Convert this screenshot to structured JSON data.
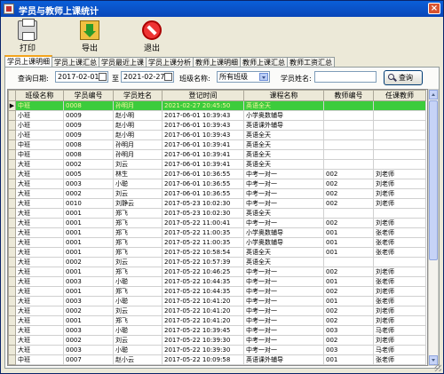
{
  "window": {
    "title": "学员与教师上课统计",
    "close_symbol": "×"
  },
  "toolbar": {
    "print": "打印",
    "export": "导出",
    "exit": "退出"
  },
  "tabs": [
    "学员上课明细",
    "学员上课汇总",
    "学员最近上课",
    "学员上课分析",
    "教师上课明细",
    "教师上课汇总",
    "教师工资汇总"
  ],
  "query": {
    "date_label": "查询日期:",
    "date_from": "2017-02-01",
    "to_label": "至",
    "date_to": "2021-02-27",
    "class_label": "班级名称:",
    "class_value": "所有班级",
    "student_label": "学员姓名:",
    "student_value": "",
    "search_button": "查询"
  },
  "table": {
    "columns": [
      "班级名称",
      "学员编号",
      "学员姓名",
      "登记时间",
      "课程名称",
      "教师编号",
      "任课教师"
    ],
    "selected_marker": "▶",
    "rows": [
      [
        "中班",
        "0008",
        "孙明月",
        "2021-02-27 20:45:50",
        "英语全天",
        "",
        ""
      ],
      [
        "小班",
        "0009",
        "赵小明",
        "2017-06-01 10:39:43",
        "小学奥数辅导",
        "",
        ""
      ],
      [
        "小班",
        "0009",
        "赵小明",
        "2017-06-01 10:39:43",
        "英语课外辅导",
        "",
        ""
      ],
      [
        "小班",
        "0009",
        "赵小明",
        "2017-06-01 10:39:43",
        "英语全天",
        "",
        ""
      ],
      [
        "中班",
        "0008",
        "孙明月",
        "2017-06-01 10:39:41",
        "英语全天",
        "",
        ""
      ],
      [
        "中班",
        "0008",
        "孙明月",
        "2017-06-01 10:39:41",
        "英语全天",
        "",
        ""
      ],
      [
        "大班",
        "0002",
        "刘云",
        "2017-06-01 10:39:41",
        "英语全天",
        "",
        ""
      ],
      [
        "大班",
        "0005",
        "林生",
        "2017-06-01 10:36:55",
        "中考一对一",
        "002",
        "刘老师"
      ],
      [
        "大班",
        "0003",
        "小聪",
        "2017-06-01 10:36:55",
        "中考一对一",
        "002",
        "刘老师"
      ],
      [
        "大班",
        "0002",
        "刘云",
        "2017-06-01 10:36:55",
        "中考一对一",
        "002",
        "刘老师"
      ],
      [
        "大班",
        "0010",
        "刘静云",
        "2017-05-23 10:02:30",
        "中考一对一",
        "002",
        "刘老师"
      ],
      [
        "大班",
        "0001",
        "郑飞",
        "2017-05-23 10:02:30",
        "英语全天",
        "",
        ""
      ],
      [
        "大班",
        "0001",
        "郑飞",
        "2017-05-22 11:00:41",
        "中考一对一",
        "002",
        "刘老师"
      ],
      [
        "大班",
        "0001",
        "郑飞",
        "2017-05-22 11:00:35",
        "小学奥数辅导",
        "001",
        "张老师"
      ],
      [
        "大班",
        "0001",
        "郑飞",
        "2017-05-22 11:00:35",
        "小学奥数辅导",
        "001",
        "张老师"
      ],
      [
        "大班",
        "0001",
        "郑飞",
        "2017-05-22 10:58:54",
        "英语全天",
        "001",
        "张老师"
      ],
      [
        "大班",
        "0002",
        "刘云",
        "2017-05-22 10:57:39",
        "英语全天",
        "",
        ""
      ],
      [
        "大班",
        "0001",
        "郑飞",
        "2017-05-22 10:46:25",
        "中考一对一",
        "002",
        "刘老师"
      ],
      [
        "大班",
        "0003",
        "小聪",
        "2017-05-22 10:44:35",
        "中考一对一",
        "001",
        "张老师"
      ],
      [
        "大班",
        "0001",
        "郑飞",
        "2017-05-22 10:44:35",
        "中考一对一",
        "002",
        "刘老师"
      ],
      [
        "大班",
        "0003",
        "小聪",
        "2017-05-22 10:41:20",
        "中考一对一",
        "001",
        "张老师"
      ],
      [
        "大班",
        "0002",
        "刘云",
        "2017-05-22 10:41:20",
        "中考一对一",
        "002",
        "刘老师"
      ],
      [
        "大班",
        "0001",
        "郑飞",
        "2017-05-22 10:41:20",
        "中考一对一",
        "002",
        "刘老师"
      ],
      [
        "大班",
        "0003",
        "小聪",
        "2017-05-22 10:39:45",
        "中考一对一",
        "003",
        "马老师"
      ],
      [
        "大班",
        "0002",
        "刘云",
        "2017-05-22 10:39:30",
        "中考一对一",
        "002",
        "刘老师"
      ],
      [
        "大班",
        "0003",
        "小聪",
        "2017-05-22 10:39:30",
        "中考一对一",
        "003",
        "马老师"
      ],
      [
        "中班",
        "0007",
        "赵小云",
        "2017-05-22 10:09:58",
        "英语课外辅导",
        "001",
        "张老师"
      ]
    ]
  },
  "colors": {
    "selected_row": "#3ccc3c",
    "title_bar": "#0a5fd8",
    "tab_highlight": "#f3a41c"
  }
}
